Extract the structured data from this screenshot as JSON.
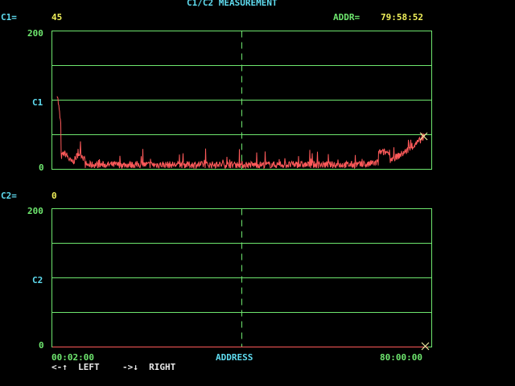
{
  "title": "C1/C2 MEASUREMENT",
  "c1": {
    "label": "C1=",
    "value": "45"
  },
  "addr": {
    "label": "ADDR=",
    "value": "79:58:52"
  },
  "c2": {
    "label": "C2=",
    "value": "0"
  },
  "plot1": {
    "ymax_label": "200",
    "ymid_label": "C1",
    "ymin_label": "0"
  },
  "plot2": {
    "ymax_label": "200",
    "ymid_label": "C2",
    "ymin_label": "0"
  },
  "xaxis": {
    "start": "00:02:00",
    "label": "ADDRESS",
    "end": "80:00:00"
  },
  "help": {
    "left": "<-↑  LEFT",
    "right": "->↓  RIGHT"
  },
  "colors": {
    "grid": "#6ee66e",
    "trace": "#ff5a5a",
    "cursor": "#e8e8a0",
    "text_cyan": "#5fdcf0",
    "text_yellow": "#f0f05a"
  }
}
